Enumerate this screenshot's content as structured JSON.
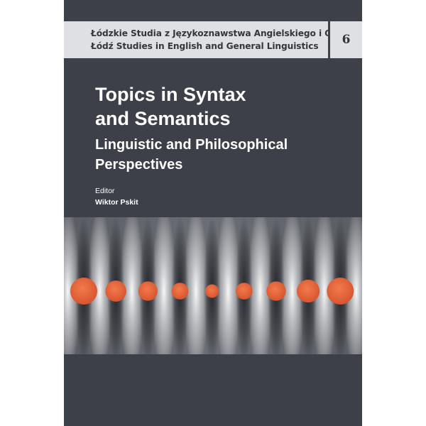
{
  "series": {
    "line1": "Łódzkie Studia z Językoznawstwa Angielskiego i Ogólnego",
    "line2": "Łódź Studies in English and General Linguistics",
    "volume": "6"
  },
  "book": {
    "title_line1": "Topics in Syntax",
    "title_line2": "and Semantics",
    "subtitle_line1": "Linguistic and Philosophical",
    "subtitle_line2": "Perspectives",
    "editor_label": "Editor",
    "editor_name": "Wiktor Pskit"
  },
  "colors": {
    "cover_background": "#3d4049",
    "band_background": "#dfe0e4",
    "dot_color": "#e8643c"
  },
  "artwork": {
    "dot_sizes_relative": [
      1.0,
      0.78,
      0.72,
      0.62,
      0.5,
      0.62,
      0.72,
      0.85,
      1.0
    ]
  }
}
